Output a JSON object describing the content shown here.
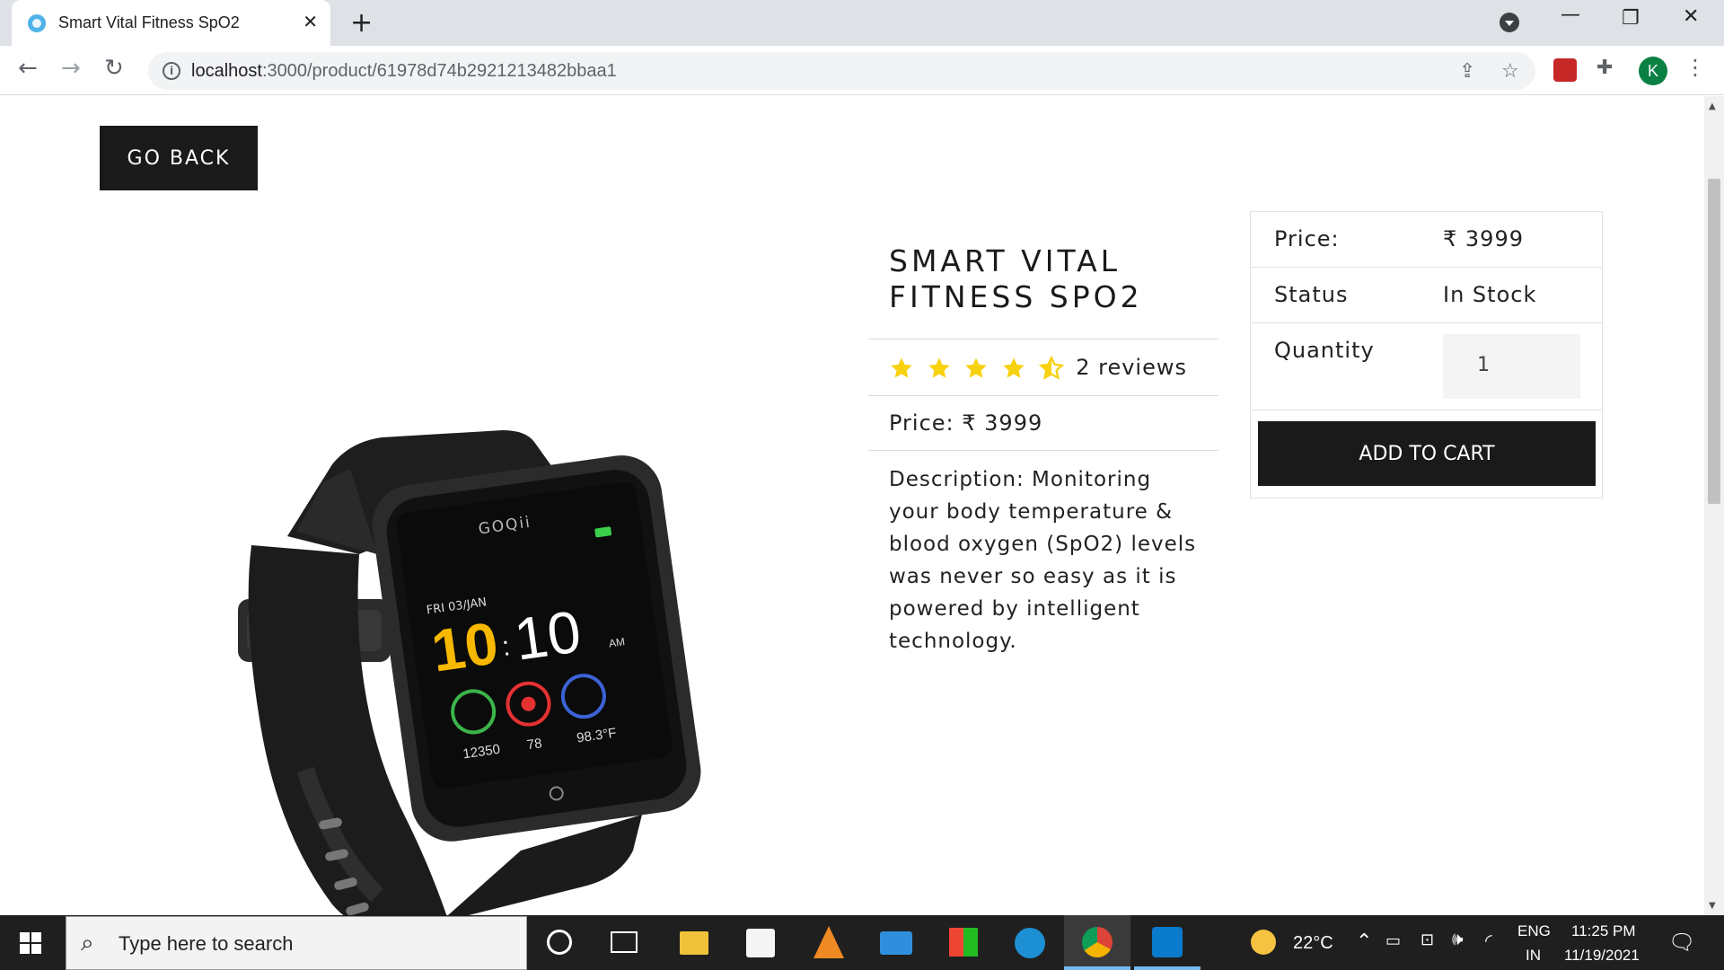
{
  "browser": {
    "tab_title": "Smart Vital Fitness SpO2",
    "tab_close": "✕",
    "new_tab": "+",
    "url_host": "localhost",
    "url_path": ":3000/product/61978d74b2921213482bbaa1",
    "profile_initial": "K",
    "icons": [
      "back-arrow-icon",
      "forward-arrow-icon",
      "reload-icon",
      "info-icon",
      "share-icon",
      "bookmark-star-icon",
      "extension-icon",
      "puzzle-icon",
      "menu-icon"
    ]
  },
  "page": {
    "go_back_label": "GO BACK",
    "product": {
      "title": "Smart Vital Fitness SpO2",
      "rating": 4.5,
      "reviews_text": "2 reviews",
      "price_line": "Price: ₹ 3999",
      "description": "Description: Monitoring your body temperature & blood oxygen (SpO2) levels was never so easy as it is powered by intelligent technology.",
      "image": {
        "brand": "GOQii",
        "date": "FRI 03/JAN",
        "hour": "10",
        "minute": "10",
        "ampm": "AM",
        "steps": "12350",
        "heart": "78",
        "temp": "98.3°F"
      }
    },
    "card": {
      "price_label": "Price:",
      "price_value": "₹ 3999",
      "status_label": "Status",
      "status_value": "In Stock",
      "quantity_label": "Quantity",
      "quantity_value": "1",
      "add_to_cart_label": "ADD TO CART"
    }
  },
  "taskbar": {
    "search_placeholder": "Type here to search",
    "weather": "22°C",
    "language_line1": "ENG",
    "language_line2": "IN",
    "time": "11:25 PM",
    "date": "11/19/2021"
  },
  "colors": {
    "button_bg": "#1a1a1a",
    "star": "#f8d10f",
    "taskbar": "#1f1f1f"
  }
}
